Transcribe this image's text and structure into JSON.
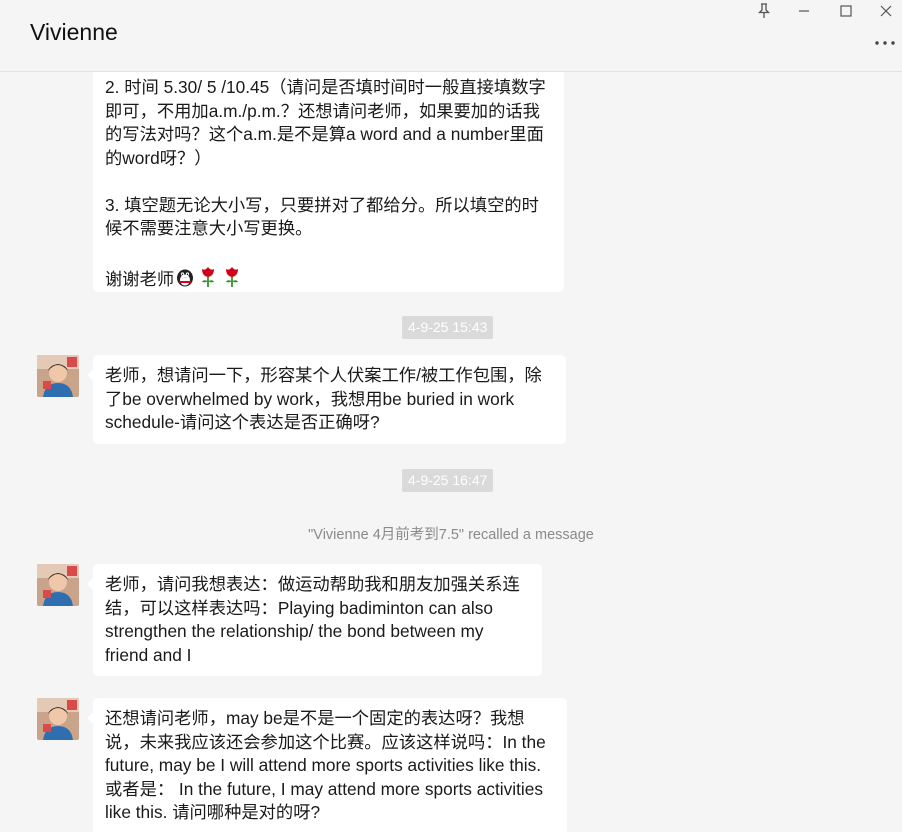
{
  "window": {
    "title": "Vivienne"
  },
  "messages": {
    "m1": {
      "line2": "2. 时间 5.30/ 5 /10.45（请问是否填时间时一般直接填数字即可，不用加a.m./p.m.？还想请问老师，如果要加的话我的写法对吗？这个a.m.是不是算a word and a number里面的word呀？）",
      "line3": "3. 填空题无论大小写，只要拼对了都给分。所以填空的时候不需要注意大小写更换。",
      "thanks": "谢谢老师"
    },
    "ts1": "4-9-25 15:43",
    "m2": "老师，想请问一下，形容某个人伏案工作/被工作包围，除了be overwhelmed by work，我想用be buried in work schedule-请问这个表达是否正确呀?",
    "ts2": "4-9-25 16:47",
    "recall": "\"Vivienne 4月前考到7.5\" recalled a message",
    "m3": "老师，请问我想表达：做运动帮助我和朋友加强关系连结，可以这样表达吗：Playing badiminton can also strengthen the relationship/ the bond between my friend and I",
    "m4": "还想请问老师，may be是不是一个固定的表达呀？我想说，未来我应该还会参加这个比赛。应该这样说吗：In the future, may be I will attend more sports activities like this. 或者是： In the future, I may attend more sports activities like this. 请问哪种是对的呀?"
  },
  "colors": {
    "background": "#f5f5f5",
    "bubble": "#ffffff",
    "timestamp_bg": "#dadada",
    "system_text": "#8a8a8a"
  },
  "icons": [
    "pin-icon",
    "minimize-icon",
    "maximize-icon",
    "close-icon",
    "more-icon",
    "qq-penguin-emoji",
    "rose-emoji",
    "avatar"
  ]
}
